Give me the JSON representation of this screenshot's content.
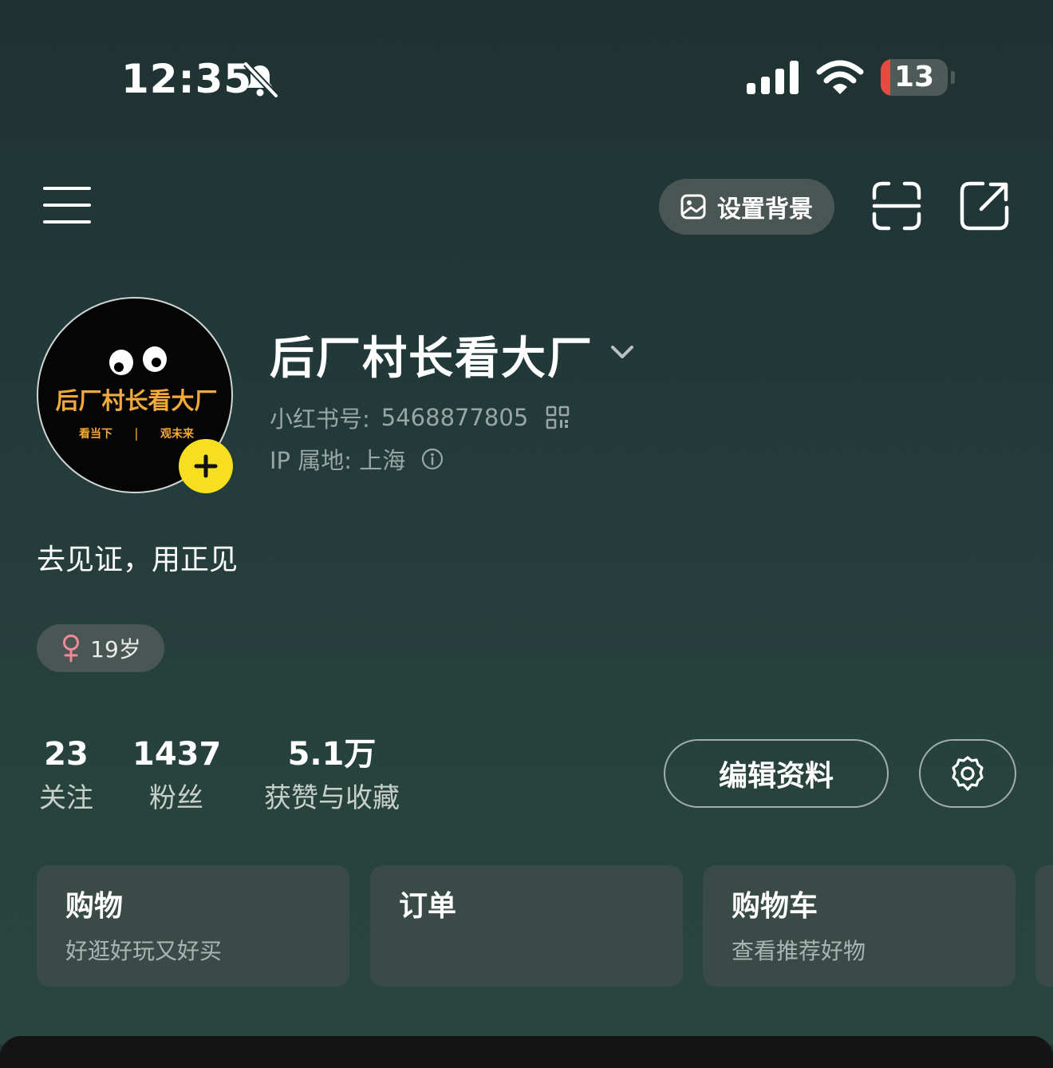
{
  "status_bar": {
    "time": "12:35",
    "battery": "13",
    "icons": [
      "bell-off-icon",
      "signal-icon",
      "wifi-icon",
      "battery-icon"
    ]
  },
  "top_bar": {
    "set_background_label": "设置背景",
    "icons": [
      "menu-icon",
      "image-icon",
      "scan-icon",
      "share-icon"
    ]
  },
  "profile": {
    "nickname": "后厂村长看大厂",
    "xhs_id_label": "小红书号:",
    "xhs_id": "5468877805",
    "ip_label": "IP 属地:",
    "ip_location": "上海",
    "bio": "去见证，用正见",
    "age_tag": "19岁",
    "avatar": {
      "title": "后厂村长看大厂",
      "subtitle_left": "看当下",
      "subtitle_sep": "|",
      "subtitle_right": "观未来"
    }
  },
  "stats": [
    {
      "value": "23",
      "label": "关注"
    },
    {
      "value": "1437",
      "label": "粉丝"
    },
    {
      "value": "5.1万",
      "label": "获赞与收藏"
    }
  ],
  "actions": {
    "edit_profile_label": "编辑资料"
  },
  "cards": [
    {
      "title": "购物",
      "subtitle": "好逛好玩又好买"
    },
    {
      "title": "订单",
      "subtitle": ""
    },
    {
      "title": "购物车",
      "subtitle": "查看推荐好物"
    }
  ],
  "colors": {
    "accent_yellow": "#f7df1f",
    "female_pink": "#f08a9a",
    "battery_red": "#e84a3f",
    "avatar_text": "#f2a93b"
  }
}
